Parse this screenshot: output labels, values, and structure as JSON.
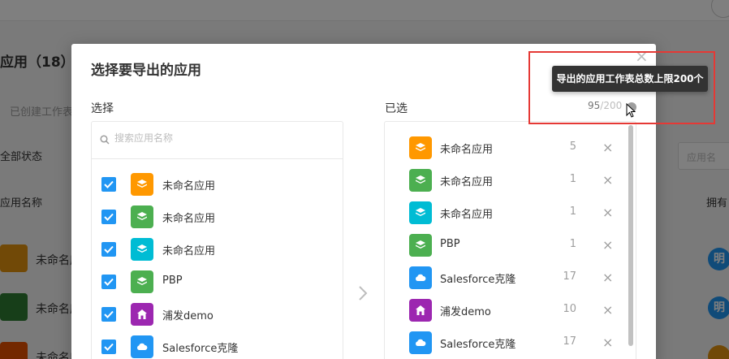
{
  "background": {
    "title": "应用（18）",
    "subtab": "已创建工作表",
    "filter": "全部状态",
    "search_placeholder": "应用名",
    "col_app_name": "应用名称",
    "col_owner": "拥有",
    "rows": [
      {
        "name": "未命名应用",
        "color": "#e3930e"
      },
      {
        "name": "未命名应用",
        "color": "#2e7d32"
      },
      {
        "name": "未命名应用",
        "color": "#e65100"
      }
    ],
    "avatar_text": "明"
  },
  "dialog": {
    "title": "选择要导出的应用",
    "close_icon": "close-icon",
    "left": {
      "label": "选择",
      "search_placeholder": "搜索应用名称",
      "items": [
        {
          "name": "未命名应用",
          "color": "#ff9800",
          "icon": "layers-icon",
          "checked": true
        },
        {
          "name": "未命名应用",
          "color": "#4caf50",
          "icon": "layers-icon",
          "checked": true
        },
        {
          "name": "未命名应用",
          "color": "#00bcd4",
          "icon": "layers-icon",
          "checked": true
        },
        {
          "name": "PBP",
          "color": "#4caf50",
          "icon": "layers-icon",
          "checked": true
        },
        {
          "name": "浦发demo",
          "color": "#9c27b0",
          "icon": "home-icon",
          "checked": true
        },
        {
          "name": "Salesforce克隆",
          "color": "#2196f3",
          "icon": "cloud-icon",
          "checked": true
        }
      ]
    },
    "right": {
      "label": "已选",
      "count_current": "95",
      "count_max": "/200",
      "items": [
        {
          "name": "未命名应用",
          "color": "#ff9800",
          "icon": "layers-icon",
          "count": "5"
        },
        {
          "name": "未命名应用",
          "color": "#4caf50",
          "icon": "layers-icon",
          "count": "1"
        },
        {
          "name": "未命名应用",
          "color": "#00bcd4",
          "icon": "layers-icon",
          "count": "1"
        },
        {
          "name": "PBP",
          "color": "#4caf50",
          "icon": "layers-icon",
          "count": "1"
        },
        {
          "name": "Salesforce克隆",
          "color": "#2196f3",
          "icon": "cloud-icon",
          "count": "17"
        },
        {
          "name": "浦发demo",
          "color": "#9c27b0",
          "icon": "home-icon",
          "count": "10"
        },
        {
          "name": "Salesforce克隆",
          "color": "#2196f3",
          "icon": "cloud-icon",
          "count": "17"
        }
      ],
      "remove_label": "×"
    },
    "tooltip": "导出的应用工作表总数上限200个"
  }
}
